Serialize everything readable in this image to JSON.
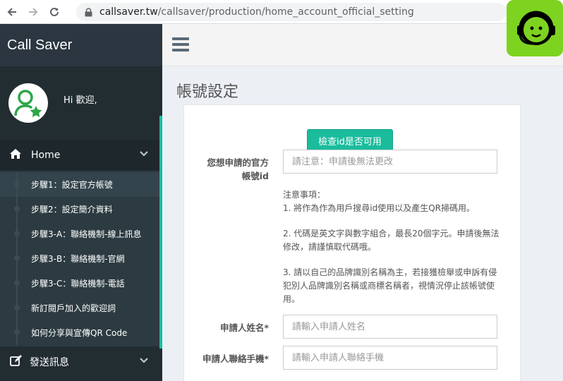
{
  "browser": {
    "url_host": "callsaver.tw",
    "url_path": "/callsaver/production/home_account_official_setting"
  },
  "sidebar": {
    "brand": "Call Saver",
    "greeting": "Hi 歡迎,",
    "home_label": "Home",
    "items": [
      {
        "label": "步驟1：設定官方帳號"
      },
      {
        "label": "步驟2：設定簡介資料"
      },
      {
        "label": "步驟3-A：聯絡機制-線上訊息"
      },
      {
        "label": "步驟3-B：聯絡機制-官網"
      },
      {
        "label": "步驟3-C：聯絡機制-電話"
      },
      {
        "label": "新訂閱戶加入的歡迎詞"
      },
      {
        "label": "如何分享與宣傳QR Code"
      }
    ],
    "send_label": "發送訊息"
  },
  "main": {
    "title": "帳號設定",
    "check_button": "檢查id是否可用",
    "id_label": "您想申請的官方帳號id",
    "id_placeholder": "請注意：申請後無法更改",
    "notes_title": "注意事項：",
    "note1": "1. 將作為作為用戶搜尋id使用以及產生QR掃碼用。",
    "note2": "2. 代碼是英文字與數字組合，最長20個字元。申請後無法修改，請謹慎取代碼哦。",
    "note3": "3. 請以自己的品牌識別名稱為主，若接獲檢舉或申訴有侵犯別人品牌識別名稱或商標名稱者，視情況停止該帳號使用。",
    "name_label": "申請人姓名*",
    "name_placeholder": "請輸入申請人姓名",
    "phone_label": "申請人聯絡手機*",
    "phone_placeholder": "請輸入申請人聯絡手機"
  },
  "colors": {
    "sidebar_bg": "#222d32",
    "accent": "#1abc9c",
    "mascot": "#7ed321"
  }
}
